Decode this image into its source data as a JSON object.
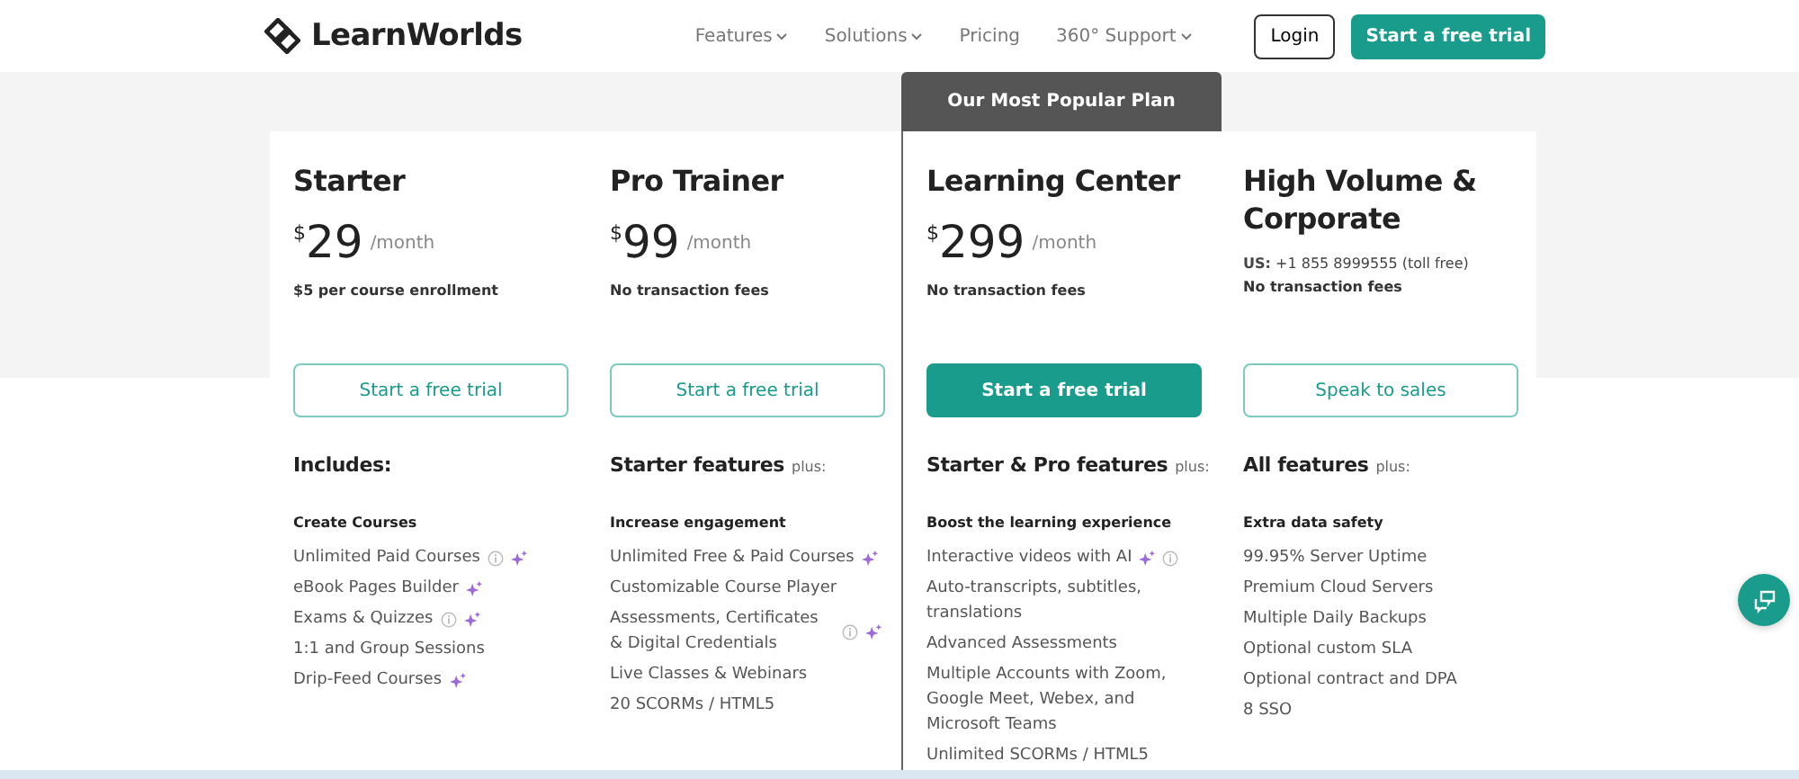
{
  "header": {
    "logo": "LearnWorlds",
    "nav": [
      {
        "label": "Features",
        "has_menu": true
      },
      {
        "label": "Solutions",
        "has_menu": true
      },
      {
        "label": "Pricing",
        "has_menu": false
      },
      {
        "label": "360° Support",
        "has_menu": true
      }
    ],
    "login": "Login",
    "cta": "Start a free trial"
  },
  "plans": [
    {
      "name": "Starter",
      "featured": false,
      "currency": "$",
      "amount": "29",
      "period": "/month",
      "note": "$5 per course enrollment",
      "button": {
        "label": "Start a free trial",
        "filled": false
      },
      "features_heading": "Includes:",
      "group": "Create Courses",
      "features": [
        {
          "text": "Unlimited Paid Courses",
          "icons": [
            {
              "kind": "info"
            },
            {
              "kind": "ai"
            }
          ]
        },
        {
          "text": "eBook Pages Builder",
          "icons": [
            {
              "kind": "ai"
            }
          ]
        },
        {
          "text": "Exams & Quizzes",
          "icons": [
            {
              "kind": "info"
            },
            {
              "kind": "ai"
            }
          ]
        },
        {
          "text": "1:1 and Group Sessions"
        },
        {
          "text": "Drip-Feed Courses",
          "icons": [
            {
              "kind": "ai"
            }
          ]
        }
      ]
    },
    {
      "name": "Pro Trainer",
      "featured": false,
      "currency": "$",
      "amount": "99",
      "period": "/month",
      "note": "No transaction fees",
      "button": {
        "label": "Start a free trial",
        "filled": false
      },
      "features_heading": "Starter features",
      "features_suffix": "plus:",
      "group": "Increase engagement",
      "features": [
        {
          "text": "Unlimited Free & Paid Courses",
          "icons": [
            {
              "kind": "ai"
            }
          ]
        },
        {
          "text": "Customizable Course Player"
        },
        {
          "text": "Assessments, Certificates & Digital Credentials",
          "icons": [
            {
              "kind": "info"
            },
            {
              "kind": "ai"
            }
          ]
        },
        {
          "text": "Live Classes & Webinars"
        },
        {
          "text": "20 SCORMs / HTML5"
        }
      ]
    },
    {
      "name": "Learning Center",
      "featured": true,
      "badge": "Our Most Popular Plan",
      "currency": "$",
      "amount": "299",
      "period": "/month",
      "note": "No transaction fees",
      "button": {
        "label": "Start a free trial",
        "filled": true
      },
      "features_heading": "Starter & Pro features",
      "features_suffix": "plus:",
      "group": "Boost the learning experience",
      "features": [
        {
          "text": "Interactive videos with AI",
          "icons": [
            {
              "kind": "ai"
            },
            {
              "kind": "info"
            }
          ]
        },
        {
          "text": "Auto-transcripts, subtitles, translations"
        },
        {
          "text": "Advanced Assessments"
        },
        {
          "text": "Multiple Accounts with Zoom, Google Meet, Webex, and Microsoft Teams"
        },
        {
          "text": "Unlimited SCORMs / HTML5"
        }
      ]
    },
    {
      "name": "High Volume & Corporate",
      "featured": false,
      "contact": "**US:** +1 855 8999555 (toll free)",
      "note": "No transaction fees",
      "button": {
        "label": "Speak to sales",
        "filled": false
      },
      "features_heading": "All features",
      "features_suffix": "plus:",
      "group": "Extra data safety",
      "features": [
        {
          "text": "99.95% Server Uptime"
        },
        {
          "text": "Premium Cloud Servers"
        },
        {
          "text": "Multiple Daily Backups"
        },
        {
          "text": "Optional custom SLA"
        },
        {
          "text": "Optional contract and DPA"
        },
        {
          "text": "8 SSO"
        }
      ]
    }
  ]
}
